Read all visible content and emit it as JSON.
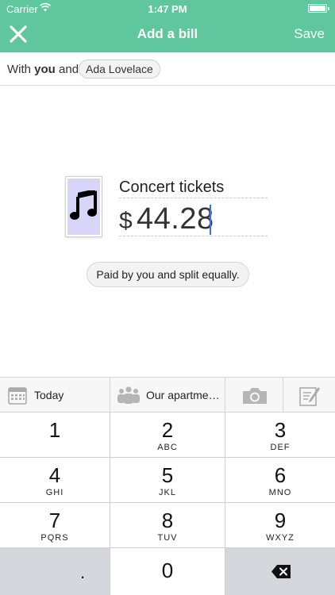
{
  "status_bar": {
    "carrier": "Carrier",
    "time": "1:47 PM"
  },
  "nav": {
    "title": "Add a bill",
    "save_label": "Save"
  },
  "with_row": {
    "prefix": "With",
    "you": "you",
    "suffix": "and:",
    "participant": "Ada Lovelace"
  },
  "bill": {
    "description": "Concert tickets",
    "currency_symbol": "$",
    "amount": "44.28",
    "split_label": "Paid by you and split equally."
  },
  "toolbar": {
    "date_label": "Today",
    "group_label": "Our apartme…"
  },
  "keypad": {
    "keys": [
      {
        "num": "1",
        "letters": ""
      },
      {
        "num": "2",
        "letters": "ABC"
      },
      {
        "num": "3",
        "letters": "DEF"
      },
      {
        "num": "4",
        "letters": "GHI"
      },
      {
        "num": "5",
        "letters": "JKL"
      },
      {
        "num": "6",
        "letters": "MNO"
      },
      {
        "num": "7",
        "letters": "PQRS"
      },
      {
        "num": "8",
        "letters": "TUV"
      },
      {
        "num": "9",
        "letters": "WXYZ"
      }
    ],
    "decimal": ".",
    "zero": "0"
  },
  "colors": {
    "header": "#5fc69e",
    "receipt_bg": "#d8d5fb",
    "caret": "#3b6ef5",
    "keypad_gray": "#d4d8dc"
  },
  "icons": [
    "wifi-icon",
    "battery-icon",
    "close-icon",
    "music-note-icon",
    "calendar-icon",
    "group-icon",
    "camera-icon",
    "notes-icon",
    "backspace-icon"
  ]
}
